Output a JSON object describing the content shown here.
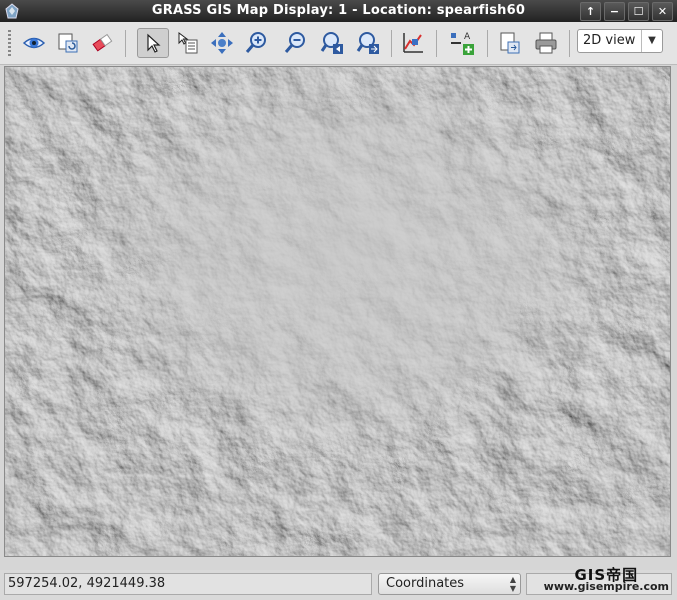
{
  "window": {
    "title": "GRASS GIS Map Display: 1 - Location: spearfish60",
    "controls": [
      "↑",
      "−",
      "☐",
      "✕"
    ]
  },
  "toolbar": {
    "tools": [
      {
        "name": "display-map-icon",
        "active": false
      },
      {
        "name": "render-map-icon",
        "active": false
      },
      {
        "name": "erase-display-icon",
        "active": false
      },
      {
        "name": "pointer-icon",
        "active": true
      },
      {
        "name": "query-raster-icon",
        "active": false
      },
      {
        "name": "pan-icon",
        "active": false
      },
      {
        "name": "zoom-in-icon",
        "active": false
      },
      {
        "name": "zoom-out-icon",
        "active": false
      },
      {
        "name": "zoom-back-icon",
        "active": false
      },
      {
        "name": "zoom-options-icon",
        "active": false
      },
      {
        "name": "analyze-icon",
        "active": false
      },
      {
        "name": "add-overlay-icon",
        "active": false
      },
      {
        "name": "save-image-icon",
        "active": false
      },
      {
        "name": "print-icon",
        "active": false
      }
    ],
    "view_mode": "2D view"
  },
  "map": {
    "description": "shaded relief hillshade raster"
  },
  "statusbar": {
    "coordinates": "597254.02, 4921449.38",
    "mode": "Coordinates"
  },
  "watermark": {
    "line1": "GIS帝国",
    "line2": "www.gisempire.com"
  }
}
